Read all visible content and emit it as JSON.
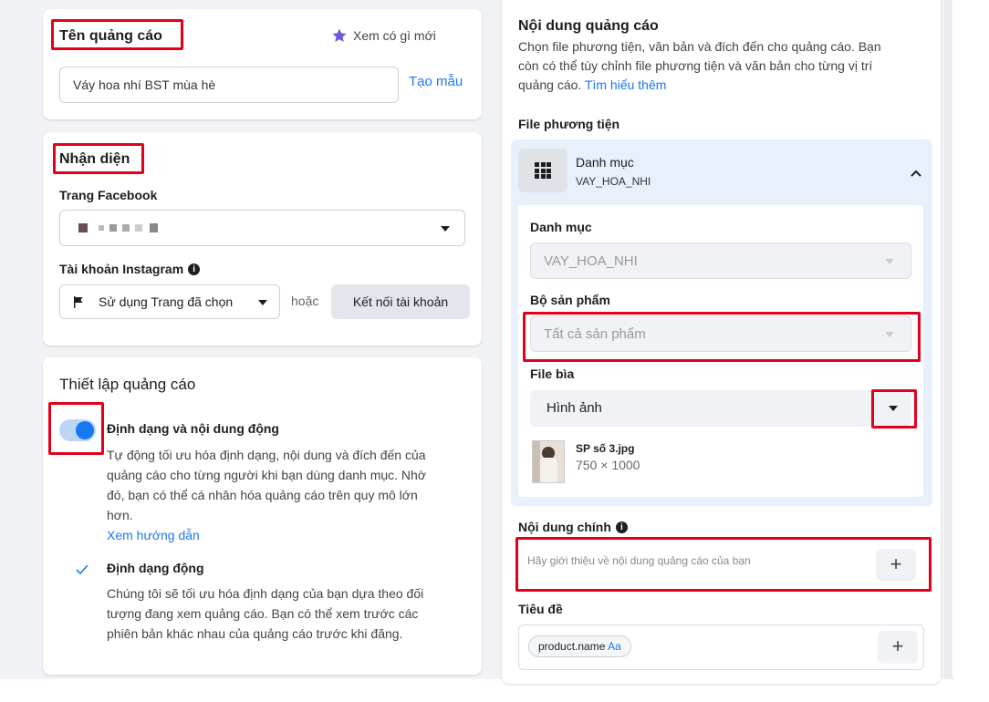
{
  "ad_name": {
    "title": "Tên quảng cáo",
    "whats_new": "Xem có gì mới",
    "input_value": "Váy hoa nhí BST mùa hè",
    "create_template": "Tạo mẫu"
  },
  "identity": {
    "title": "Nhận diện",
    "facebook_page_label": "Trang Facebook",
    "instagram_label": "Tài khoản Instagram",
    "instagram_select": "Sử dụng Trang đã chọn",
    "or_text": "hoặc",
    "connect_button": "Kết nối tài khoản"
  },
  "ad_setup": {
    "title": "Thiết lập quảng cáo",
    "dynamic_title": "Định dạng và nội dung động",
    "dynamic_desc_1": "Tự động tối ưu hóa định dạng, nội dung và đích đến của",
    "dynamic_desc_2": "quảng cáo cho từng người khi bạn dùng danh mục. Nhờ",
    "dynamic_desc_3": "đó, bạn có thể cá nhân hóa quảng cáo trên quy mô lớn",
    "dynamic_desc_4": "hơn.",
    "guide_link": "Xem hướng dẫn",
    "dynamic_format_title": "Định dạng động",
    "dynamic_format_desc_1": "Chúng tôi sẽ tối ưu hóa định dạng của bạn dựa theo đối",
    "dynamic_format_desc_2": "tượng đang xem quảng cáo. Bạn có thể xem trước các",
    "dynamic_format_desc_3": "phiên bản khác nhau của quảng cáo trước khi đăng.",
    "toggle_on": true
  },
  "ad_content": {
    "title": "Nội dung quảng cáo",
    "desc_1": "Chọn file phương tiện, văn bản và đích đến cho quảng cáo. Bạn",
    "desc_2": "còn có thể tùy chỉnh file phương tiện và văn bản cho từng vị trí",
    "desc_3": "quảng cáo.",
    "learn_more": "Tìm hiểu thêm",
    "media_label": "File phương tiện",
    "catalog_header": "Danh mục",
    "catalog_sub": "VAY_HOA_NHI",
    "catalog_label": "Danh mục",
    "catalog_value": "VAY_HOA_NHI",
    "product_set_label": "Bộ sản phẩm",
    "product_set_value": "Tất cả sản phẩm",
    "cover_label": "File bìa",
    "cover_value": "Hình ảnh",
    "file_name": "SP số 3.jpg",
    "file_size": "750 × 1000",
    "primary_text_label": "Nội dung chính",
    "primary_text_placeholder": "Hãy giới thiệu về nội dung quảng cáo của bạn",
    "headline_label": "Tiêu đề",
    "headline_token": "product.name",
    "headline_token_suffix": "Aa"
  },
  "colors": {
    "accent": "#1877f2",
    "highlight": "#e4001b",
    "star": "#6b5bd6"
  }
}
